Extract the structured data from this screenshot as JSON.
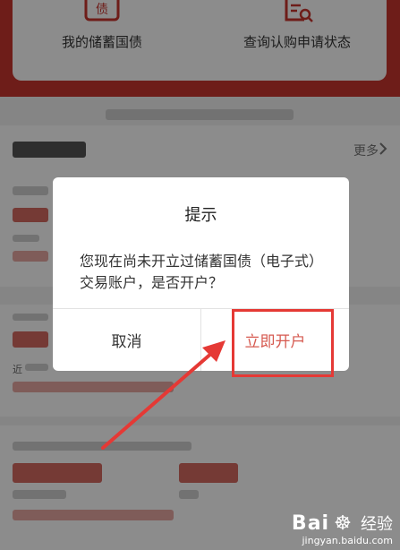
{
  "quick_actions": [
    {
      "label": "我的储蓄国债",
      "icon": "bond-certificate-icon"
    },
    {
      "label": "查询认购申请状态",
      "icon": "document-search-icon"
    }
  ],
  "list": {
    "more_label": "更多",
    "near_label": "近"
  },
  "dialog": {
    "title": "提示",
    "message": "您现在尚未开立过储蓄国债（电子式）交易账户，是否开户？",
    "cancel_label": "取消",
    "confirm_label": "立即开户"
  },
  "watermark": {
    "logo_text": "Bai",
    "logo_suffix": "经验",
    "url": "jingyan.baidu.com"
  },
  "colors": {
    "brand_red": "#c9352f",
    "confirm_text": "#d65a50",
    "annotation_red": "#e53935"
  }
}
